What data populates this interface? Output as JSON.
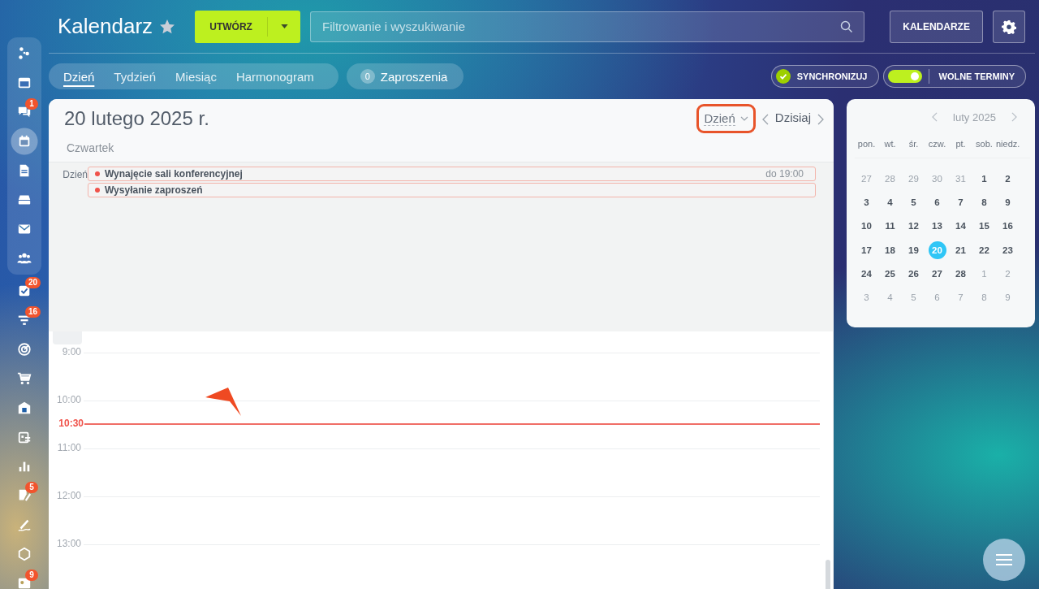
{
  "sidebar": {
    "pinned": [
      {
        "kind": "network",
        "selected": false
      },
      {
        "kind": "window",
        "selected": false
      },
      {
        "kind": "chat",
        "badge": "1",
        "selected": false
      },
      {
        "kind": "calendar",
        "selected": true
      },
      {
        "kind": "document",
        "selected": false
      },
      {
        "kind": "drive",
        "selected": false
      },
      {
        "kind": "mail",
        "selected": false
      },
      {
        "kind": "people",
        "selected": false
      }
    ],
    "items": [
      {
        "kind": "tasks",
        "badge": "20",
        "selected": false
      },
      {
        "kind": "filter",
        "badge": "16",
        "selected": false
      },
      {
        "kind": "target",
        "selected": false
      },
      {
        "kind": "cart",
        "selected": false
      },
      {
        "kind": "store",
        "selected": false
      },
      {
        "kind": "schedule",
        "selected": false
      },
      {
        "kind": "chart",
        "selected": false
      },
      {
        "kind": "edit",
        "badge": "5",
        "selected": false
      },
      {
        "kind": "sign",
        "selected": false
      },
      {
        "kind": "hexagon",
        "selected": false
      },
      {
        "kind": "contact",
        "badge": "9",
        "selected": false
      }
    ]
  },
  "header": {
    "title": "Kalendarz",
    "favorite": true,
    "create_button": "UTWÓRZ",
    "search": {
      "placeholder": "Filtrowanie i wyszukiwanie"
    },
    "calendars_button": "KALENDARZE"
  },
  "tabs": [
    {
      "label": "Dzień",
      "selected": true
    },
    {
      "label": "Tydzień",
      "selected": false
    },
    {
      "label": "Miesiąc",
      "selected": false
    },
    {
      "label": "Harmonogram",
      "selected": false
    }
  ],
  "invitations": {
    "count": "0",
    "label": "Zaproszenia"
  },
  "sync": {
    "label": "SYNCHRONIZUJ",
    "checked": true
  },
  "free_slots": {
    "label": "WOLNE TERMINY",
    "on": true
  },
  "day_view": {
    "date": "20 lutego 2025 r.",
    "weekday": "Czwartek",
    "view_select": {
      "label": "Dzień",
      "annotated": true
    },
    "today_button": "Dzisiaj",
    "all_day_label": "Dzień",
    "events": [
      {
        "title": "Wynajęcie sali konferencyjnej",
        "until": "do 19:00"
      },
      {
        "title": "Wysyłanie zaproszeń"
      }
    ],
    "hours": [
      {
        "label": "9:00"
      },
      {
        "label": "10:00",
        "now": "10:30"
      },
      {
        "label": "11:00"
      },
      {
        "label": "12:00"
      },
      {
        "label": "13:00"
      }
    ],
    "pointer_arrow": true
  },
  "mini_calendar": {
    "title": "luty 2025",
    "weekdays": [
      "pon.",
      "wt.",
      "śr.",
      "czw.",
      "pt.",
      "sob.",
      "niedz."
    ],
    "weeks": [
      [
        {
          "label": "27",
          "muted": true,
          "selected": false
        },
        {
          "label": "28",
          "muted": true,
          "selected": false
        },
        {
          "label": "29",
          "muted": true,
          "selected": false
        },
        {
          "label": "30",
          "muted": true,
          "selected": false
        },
        {
          "label": "31",
          "muted": true,
          "selected": false
        },
        {
          "label": "1",
          "muted": false,
          "selected": false
        },
        {
          "label": "2",
          "muted": false,
          "selected": false
        }
      ],
      [
        {
          "label": "3",
          "muted": false,
          "selected": false
        },
        {
          "label": "4",
          "muted": false,
          "selected": false
        },
        {
          "label": "5",
          "muted": false,
          "selected": false
        },
        {
          "label": "6",
          "muted": false,
          "selected": false
        },
        {
          "label": "7",
          "muted": false,
          "selected": false
        },
        {
          "label": "8",
          "muted": false,
          "selected": false
        },
        {
          "label": "9",
          "muted": false,
          "selected": false
        }
      ],
      [
        {
          "label": "10",
          "muted": false,
          "selected": false
        },
        {
          "label": "11",
          "muted": false,
          "selected": false
        },
        {
          "label": "12",
          "muted": false,
          "selected": false
        },
        {
          "label": "13",
          "muted": false,
          "selected": false
        },
        {
          "label": "14",
          "muted": false,
          "selected": false
        },
        {
          "label": "15",
          "muted": false,
          "selected": false
        },
        {
          "label": "16",
          "muted": false,
          "selected": false
        }
      ],
      [
        {
          "label": "17",
          "muted": false,
          "selected": false
        },
        {
          "label": "18",
          "muted": false,
          "selected": false
        },
        {
          "label": "19",
          "muted": false,
          "selected": false
        },
        {
          "label": "20",
          "muted": false,
          "selected": true
        },
        {
          "label": "21",
          "muted": false,
          "selected": false
        },
        {
          "label": "22",
          "muted": false,
          "selected": false
        },
        {
          "label": "23",
          "muted": false,
          "selected": false
        }
      ],
      [
        {
          "label": "24",
          "muted": false,
          "selected": false
        },
        {
          "label": "25",
          "muted": false,
          "selected": false
        },
        {
          "label": "26",
          "muted": false,
          "selected": false
        },
        {
          "label": "27",
          "muted": false,
          "selected": false
        },
        {
          "label": "28",
          "muted": false,
          "selected": false
        },
        {
          "label": "1",
          "muted": true,
          "selected": false
        },
        {
          "label": "2",
          "muted": true,
          "selected": false
        }
      ],
      [
        {
          "label": "3",
          "muted": true,
          "selected": false
        },
        {
          "label": "4",
          "muted": true,
          "selected": false
        },
        {
          "label": "5",
          "muted": true,
          "selected": false
        },
        {
          "label": "6",
          "muted": true,
          "selected": false
        },
        {
          "label": "7",
          "muted": true,
          "selected": false
        },
        {
          "label": "8",
          "muted": true,
          "selected": false
        },
        {
          "label": "9",
          "muted": true,
          "selected": false
        }
      ]
    ]
  }
}
